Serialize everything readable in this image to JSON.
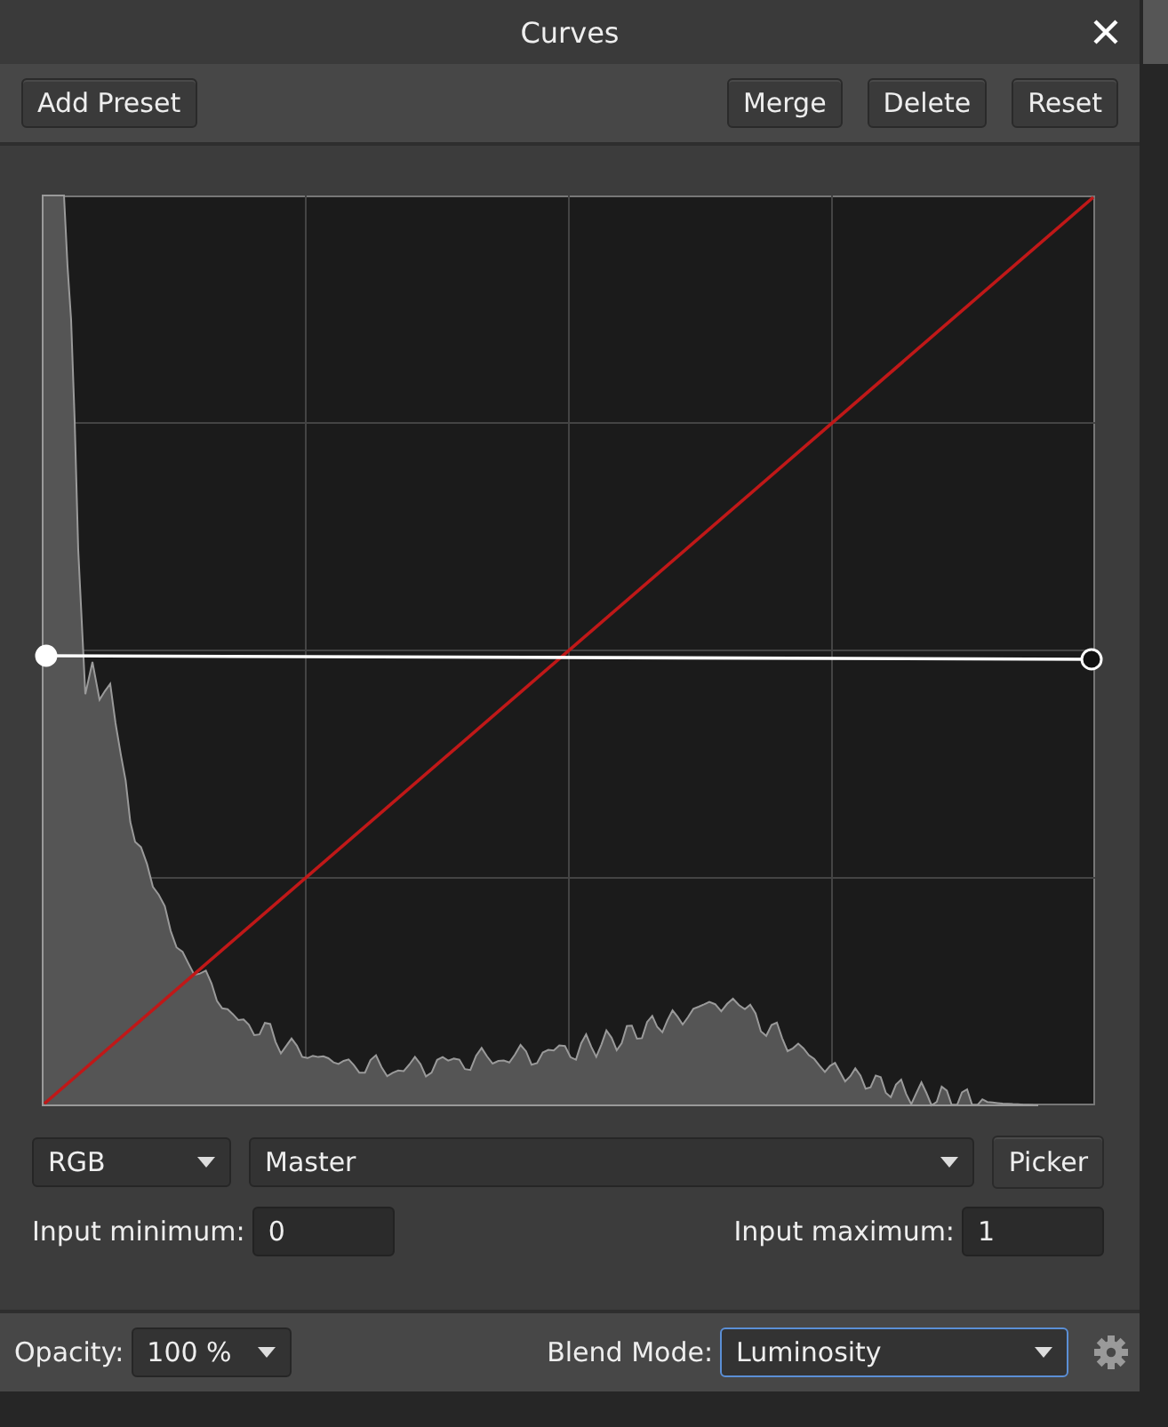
{
  "window": {
    "title": "Curves"
  },
  "toolbar": {
    "left": [
      {
        "label": "Add Preset"
      }
    ],
    "right": [
      {
        "label": "Merge"
      },
      {
        "label": "Delete"
      },
      {
        "label": "Reset"
      }
    ]
  },
  "graph": {
    "handles": [
      {
        "selected": true
      },
      {
        "selected": false
      }
    ]
  },
  "channel": {
    "color_space": "RGB",
    "channel": "Master",
    "picker": "Picker"
  },
  "inputs": [
    {
      "label": "Input minimum:",
      "value": "0"
    },
    {
      "label": "Input maximum:",
      "value": "1"
    }
  ],
  "footer": {
    "opacity_label": "Opacity:",
    "opacity": "100 %",
    "blend_label": "Blend Mode:",
    "blend": "Luminosity",
    "blend_focused": true
  }
}
